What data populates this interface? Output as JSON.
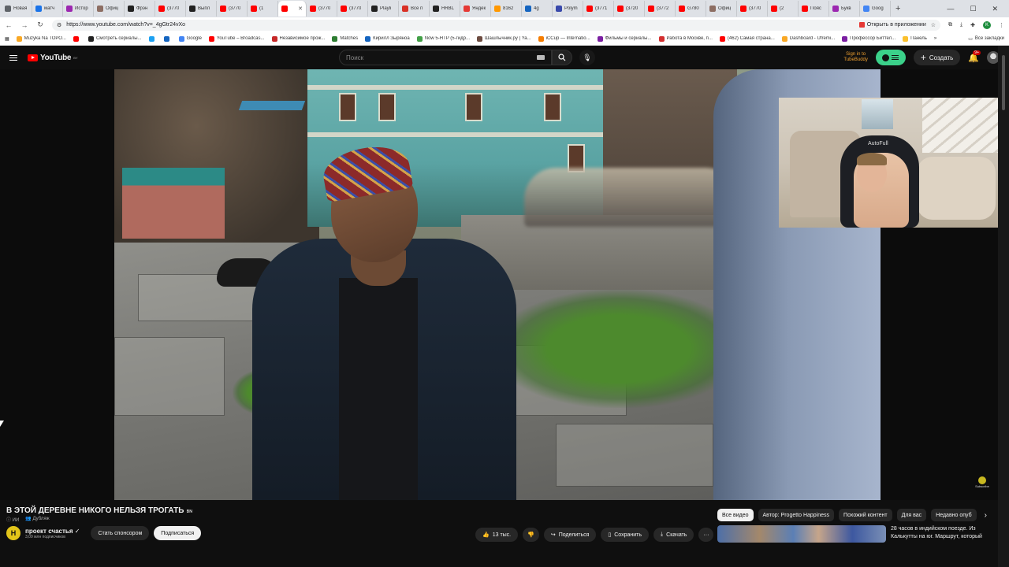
{
  "browser": {
    "tabs": [
      {
        "label": "Новая",
        "color": "#5f6368"
      },
      {
        "label": "матч",
        "color": "#1a73e8"
      },
      {
        "label": "Истор",
        "color": "#9c27b0"
      },
      {
        "label": "Офиц",
        "color": "#8d6e63"
      },
      {
        "label": "Фрэн",
        "color": "#212121"
      },
      {
        "label": "(3770",
        "color": "#ff0000"
      },
      {
        "label": "Выпл",
        "color": "#212121"
      },
      {
        "label": "(3770",
        "color": "#ff0000"
      },
      {
        "label": "(1",
        "color": "#ff0000"
      },
      {
        "label": "",
        "color": "#ff0000",
        "active": true
      },
      {
        "label": "(3770",
        "color": "#ff0000"
      },
      {
        "label": "(3770",
        "color": "#ff0000"
      },
      {
        "label": "Playli",
        "color": "#212121"
      },
      {
        "label": "Все п",
        "color": "#d93025"
      },
      {
        "label": "HRBL",
        "color": "#212121"
      },
      {
        "label": "Яндек",
        "color": "#e53935"
      },
      {
        "label": "8162",
        "color": "#ff9800"
      },
      {
        "label": "4g",
        "color": "#1565c0"
      },
      {
        "label": "Polym",
        "color": "#3949ab"
      },
      {
        "label": "(3771",
        "color": "#ff0000"
      },
      {
        "label": "(3720",
        "color": "#ff0000"
      },
      {
        "label": "(3772",
        "color": "#ff0000"
      },
      {
        "label": "G780",
        "color": "#ff0000"
      },
      {
        "label": "Офиц",
        "color": "#8d6e63"
      },
      {
        "label": "(3770",
        "color": "#ff0000"
      },
      {
        "label": "(2",
        "color": "#ff0000"
      },
      {
        "label": "Пояс",
        "color": "#ff0000"
      },
      {
        "label": "Букв",
        "color": "#9c27b0"
      },
      {
        "label": "Goog",
        "color": "#4285f4"
      }
    ],
    "new_tab": "+",
    "url": "https://www.youtube.com/watch?v=_4gGtr24vXo",
    "open_in_app": "Открыть в приложении",
    "profile_initial": "K",
    "bookmarks": [
      {
        "label": "Muzyka Na ТОРО...",
        "color": "#f9a825"
      },
      {
        "label": "",
        "color": "#ff0000"
      },
      {
        "label": "Смотреть сериалы...",
        "color": "#212121"
      },
      {
        "label": "",
        "color": "#1da1f2"
      },
      {
        "label": "",
        "color": "#1565c0"
      },
      {
        "label": "Google",
        "color": "#4285f4"
      },
      {
        "label": "YouTube – Broadcas...",
        "color": "#ff0000"
      },
      {
        "label": "Независимое прож...",
        "color": "#c62828"
      },
      {
        "label": "Matches",
        "color": "#2e7d32"
      },
      {
        "label": "Кирилл Зыряноа",
        "color": "#1565c0"
      },
      {
        "label": "Now 5-HTP (5-гидр...",
        "color": "#43a047"
      },
      {
        "label": "Шашлычник.ру | Ya...",
        "color": "#6d4c41"
      },
      {
        "label": "iCCup — Internatio...",
        "color": "#f57c00"
      },
      {
        "label": "Фильмы и сериалы...",
        "color": "#7b1fa2"
      },
      {
        "label": "Работа в Москве, п...",
        "color": "#d32f2f"
      },
      {
        "label": "(462) Самая страна...",
        "color": "#ff0000"
      },
      {
        "label": "Dashboard - Ufremi...",
        "color": "#f9a825"
      },
      {
        "label": "Профессор Биттел...",
        "color": "#7b1fa2"
      },
      {
        "label": "Панель",
        "color": "#fbc02d"
      }
    ],
    "bookmarks_more": "»",
    "all_bookmarks": "Все закладки"
  },
  "youtube": {
    "logo": "YouTube",
    "region": "BY",
    "search_placeholder": "Поиск",
    "tubebuddy_line1": "Sign in to",
    "tubebuddy_line2": "TubeBuddy",
    "create_label": "Создать",
    "notifications_badge": "9+"
  },
  "webcam": {
    "chair_brand": "AutoFull"
  },
  "watermark": {
    "label": "Subscribe"
  },
  "video": {
    "title": "В ЭТОЙ ДЕРЕВНЕ НИКОГО НЕЛЬЗЯ ТРОГАТЬ",
    "title_badge": "ʙɴ",
    "badge_ai": "ИИ",
    "badge_dub": "Дубляж",
    "channel_name": "проект счастья",
    "channel_subs": "3,09 млн подписчиков",
    "channel_avatar": "H",
    "sponsor_label": "Стать спонсором",
    "subscribe_label": "Подписаться",
    "likes": "13 тыс.",
    "share_label": "Поделиться",
    "save_label": "Сохранить",
    "download_label": "Скачать",
    "more_label": "···"
  },
  "sidebar": {
    "chips": [
      {
        "label": "Все видео",
        "active": true
      },
      {
        "label": "Автор: Progetto Happiness"
      },
      {
        "label": "Похожий контент"
      },
      {
        "label": "Для вас"
      },
      {
        "label": "Недавно опуб"
      }
    ],
    "chip_next": "›",
    "recommendation_title": "28 часов в индийском поезде. Из Калькутты на юг. Маршрут, который"
  }
}
